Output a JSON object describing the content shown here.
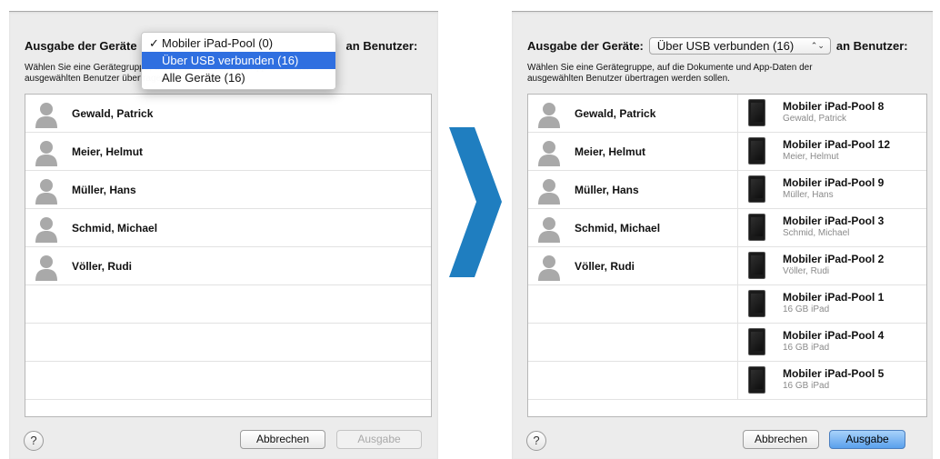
{
  "colors": {
    "accent": "#2f6fe0",
    "chevron": "#1f7ec0",
    "primary_button": "#5aa0ec"
  },
  "left": {
    "heading_prefix": "Ausgabe der Geräte",
    "heading_suffix": "an Benutzer:",
    "desc_line1_visible": "Wählen Sie eine Gerätegruppe, auf die Dokumente und App-Daten der",
    "desc_line2_visible": "ausgewählten Benutzer übertragen werden sollen.",
    "dropdown": {
      "items": [
        {
          "label": "Mobiler iPad-Pool (0)",
          "checked": true
        },
        {
          "label": "Über USB verbunden (16)",
          "highlighted": true
        },
        {
          "label": "Alle Geräte (16)"
        }
      ],
      "check_mark": "✓"
    },
    "users": [
      "Gewald, Patrick",
      "Meier, Helmut",
      "Müller, Hans",
      "Schmid, Michael",
      "Völler, Rudi"
    ],
    "help_label": "?",
    "cancel_label": "Abbrechen",
    "ok_label": "Ausgabe"
  },
  "right": {
    "heading_prefix": "Ausgabe der Geräte:",
    "popup_value": "Über USB verbunden (16)",
    "popup_arrows": "⌃⌄",
    "heading_suffix": "an Benutzer:",
    "desc_line1": "Wählen Sie eine Gerätegruppe, auf die Dokumente und App-Daten der",
    "desc_line2": "ausgewählten Benutzer übertragen werden sollen.",
    "users": [
      "Gewald, Patrick",
      "Meier, Helmut",
      "Müller, Hans",
      "Schmid, Michael",
      "Völler, Rudi",
      "",
      "",
      ""
    ],
    "devices": [
      {
        "name": "Mobiler iPad-Pool 8",
        "sub": "Gewald, Patrick"
      },
      {
        "name": "Mobiler iPad-Pool 12",
        "sub": "Meier, Helmut"
      },
      {
        "name": "Mobiler iPad-Pool 9",
        "sub": "Müller, Hans"
      },
      {
        "name": "Mobiler iPad-Pool 3",
        "sub": "Schmid, Michael"
      },
      {
        "name": "Mobiler iPad-Pool 2",
        "sub": "Völler, Rudi"
      },
      {
        "name": "Mobiler iPad-Pool 1",
        "sub": "16 GB iPad"
      },
      {
        "name": "Mobiler iPad-Pool 4",
        "sub": "16 GB iPad"
      },
      {
        "name": "Mobiler iPad-Pool 5",
        "sub": "16 GB iPad"
      }
    ],
    "help_label": "?",
    "cancel_label": "Abbrechen",
    "ok_label": "Ausgabe"
  }
}
